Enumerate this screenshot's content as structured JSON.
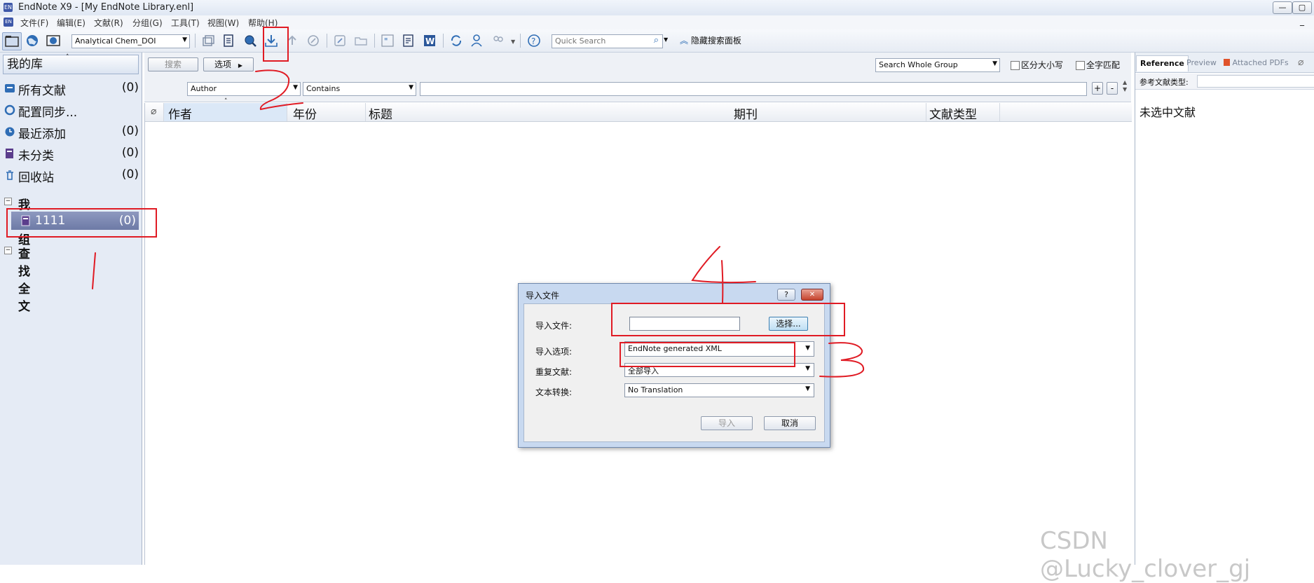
{
  "window": {
    "title": "EndNote X9 - [My EndNote Library.enl]",
    "app_icon": "EN"
  },
  "menu": [
    "文件(F)",
    "编辑(E)",
    "文献(R)",
    "分组(G)",
    "工具(T)",
    "视图(W)",
    "帮助(H)"
  ],
  "toolbar": {
    "style_value": "Analytical Chem_DOI",
    "quick_search_placeholder": "Quick Search",
    "hide_search_panel": "隐藏搜索面板"
  },
  "sidebar": {
    "header": "我的库",
    "items": [
      {
        "label": "所有文献",
        "count": "(0)"
      },
      {
        "label": "配置同步...",
        "count": ""
      },
      {
        "label": "最近添加",
        "count": "(0)"
      },
      {
        "label": "未分类",
        "count": "(0)"
      },
      {
        "label": "回收站",
        "count": "(0)"
      }
    ],
    "groups_header": "我的组",
    "group": {
      "label": "1111",
      "count": "(0)"
    },
    "find_fulltext": "查找全文"
  },
  "search": {
    "search_button": "搜索",
    "options_button": "选项",
    "scope_value": "Search Whole Group",
    "match_case": "区分大小写",
    "match_words": "全字匹配",
    "field_value": "Author",
    "operator_value": "Contains",
    "plus": "+",
    "minus": "-"
  },
  "columns": [
    "作者",
    "年份",
    "标题",
    "期刊",
    "文献类型"
  ],
  "right_panel": {
    "tabs": [
      "Reference",
      "Preview",
      "Attached PDFs"
    ],
    "ref_type_label": "参考文献类型:",
    "empty_text": "未选中文献"
  },
  "dialog": {
    "title": "导入文件",
    "help": "?",
    "close": "✕",
    "file_label": "导入文件:",
    "choose_button": "选择...",
    "option_label": "导入选项:",
    "option_value": "EndNote generated XML",
    "duplicates_label": "重复文献:",
    "duplicates_value": "全部导入",
    "translation_label": "文本转换:",
    "translation_value": "No Translation",
    "import_button": "导入",
    "cancel_button": "取消"
  },
  "watermark": "CSDN @Lucky_clover_gj",
  "annotation_color": "#e01b24"
}
